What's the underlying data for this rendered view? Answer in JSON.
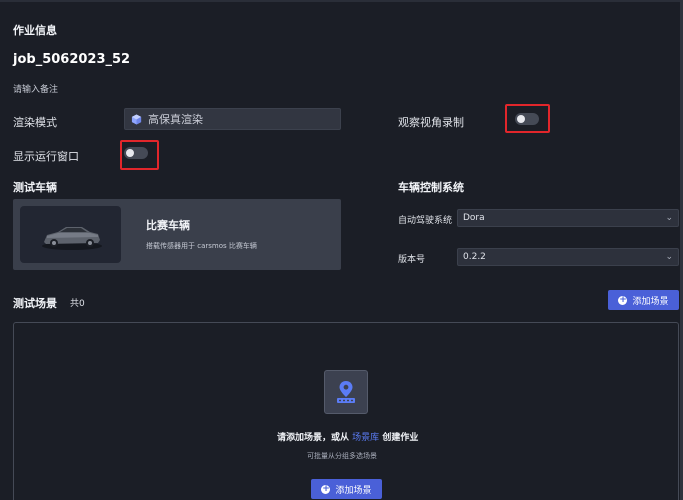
{
  "job_info": {
    "section_title": "作业信息",
    "job_name": "job_5062023_52",
    "note_placeholder": "请输入备注"
  },
  "render": {
    "label": "渲染模式",
    "value": "高保真渲染",
    "icon": "cube-icon"
  },
  "observer_record": {
    "label": "观察视角录制",
    "enabled": false
  },
  "show_window": {
    "label": "显示运行窗口",
    "enabled": false
  },
  "test_vehicle": {
    "section_title": "测试车辆",
    "card_title": "比赛车辆",
    "card_desc": "搭载传感器用于 carsmos 比赛车辆"
  },
  "vehicle_control": {
    "section_title": "车辆控制系统",
    "autodrive_label": "自动驾驶系统",
    "autodrive_value": "Dora",
    "version_label": "版本号",
    "version_value": "0.2.2"
  },
  "test_scene": {
    "section_title": "测试场景",
    "count_text": "共0",
    "add_button": "添加场景",
    "empty_prefix": "请添加场景，或从",
    "empty_link": "场景库",
    "empty_suffix": "创建作业",
    "empty_hint": "可批量从分组多选场景",
    "add_button_bottom": "添加场景"
  },
  "colors": {
    "accent": "#4a60d8",
    "link": "#5b7cf5",
    "highlight_box": "#e2262b",
    "background": "#1b1e26"
  }
}
